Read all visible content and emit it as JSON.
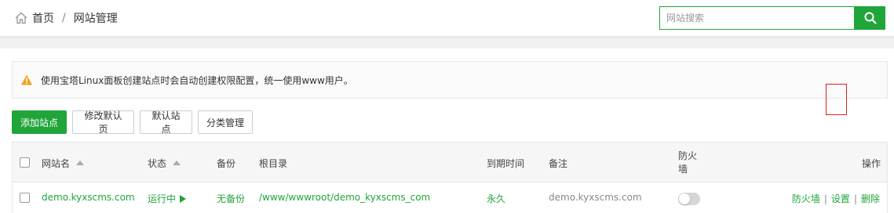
{
  "breadcrumb": {
    "home_label": "首页",
    "separator": "/",
    "current_label": "网站管理"
  },
  "search": {
    "placeholder": "网站搜索",
    "value": ""
  },
  "alert": {
    "text": "使用宝塔Linux面板创建站点时会自动创建权限配置，统一使用www用户。"
  },
  "toolbar": {
    "add_site_label": "添加站点",
    "edit_default_page_label": "修改默认页",
    "default_site_label": "默认站点",
    "category_manage_label": "分类管理"
  },
  "table": {
    "columns": {
      "site_name": "网站名",
      "status": "状态",
      "backup": "备份",
      "root_dir": "根目录",
      "expiry": "到期时间",
      "remark": "备注",
      "firewall": "防火墙",
      "actions": "操作"
    },
    "rows": [
      {
        "site_name": "demo.kyxscms.com",
        "status": "运行中",
        "backup": "无备份",
        "root_dir": "/www/wwwroot/demo_kyxscms_com",
        "expiry": "永久",
        "remark": "demo.kyxscms.com",
        "firewall_enabled": false,
        "actions": {
          "firewall": "防火墙",
          "settings": "设置",
          "delete": "删除",
          "separator": "|"
        }
      }
    ]
  },
  "colors": {
    "accent": "#20a53a",
    "highlight_box": "#e02020",
    "warning": "#f0a020"
  },
  "icons": {
    "home": "home-icon",
    "search": "search-icon",
    "warning": "warning-icon",
    "sort": "sort-up-icon",
    "play": "play-icon"
  }
}
